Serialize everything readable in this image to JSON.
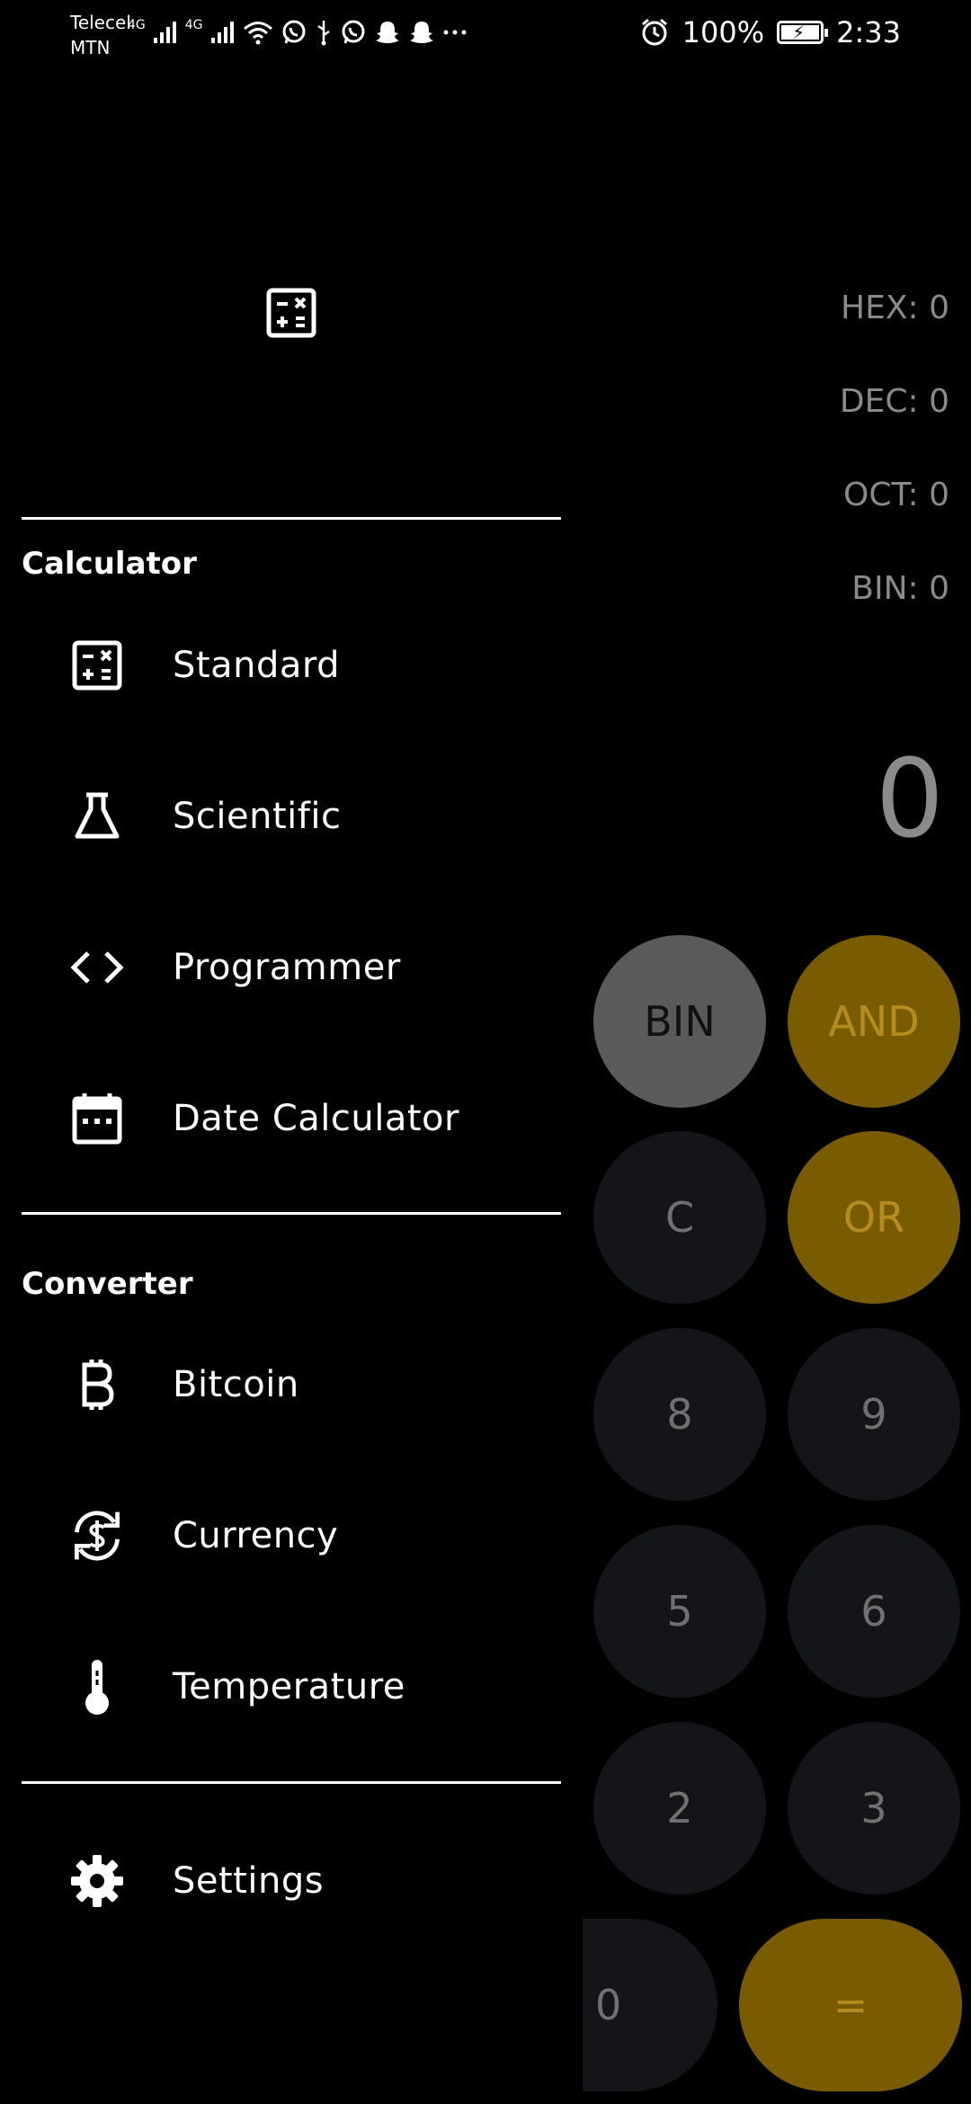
{
  "status_bar": {
    "carrier_1": "Telecel",
    "carrier_2": "MTN",
    "network_1": "4G",
    "network_2": "4G",
    "battery_percent": "100%",
    "time": "2:33"
  },
  "calculator": {
    "readouts": {
      "hex": "HEX: 0",
      "dec": "DEC: 0",
      "oct": "OCT: 0",
      "bin": "BIN: 0"
    },
    "display": "0",
    "keys": {
      "bin": "BIN",
      "and": "AND",
      "clear": "C",
      "or": "OR",
      "eight": "8",
      "nine": "9",
      "five": "5",
      "six": "6",
      "two": "2",
      "three": "3",
      "zero": "0",
      "equals": "="
    },
    "colors": {
      "accent": "#7a5c00",
      "key_dark": "#141518",
      "key_gray": "#5a5a5a"
    }
  },
  "drawer": {
    "sections": {
      "calculator_title": "Calculator",
      "converter_title": "Converter"
    },
    "items": {
      "standard": "Standard",
      "scientific": "Scientific",
      "programmer": "Programmer",
      "date_calculator": "Date Calculator",
      "bitcoin": "Bitcoin",
      "currency": "Currency",
      "temperature": "Temperature",
      "settings": "Settings"
    },
    "icons": [
      "calculator-icon",
      "flask-icon",
      "code-icon",
      "calendar-icon",
      "bitcoin-icon",
      "currency-exchange-icon",
      "thermometer-icon",
      "gear-icon"
    ]
  }
}
